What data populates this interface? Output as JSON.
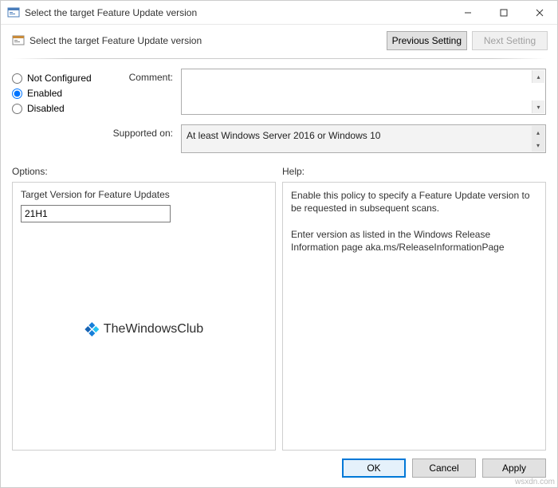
{
  "window": {
    "title": "Select the target Feature Update version"
  },
  "header": {
    "title": "Select the target Feature Update version",
    "prev_button": "Previous Setting",
    "next_button": "Next Setting"
  },
  "config": {
    "radios": {
      "not_configured": "Not Configured",
      "enabled": "Enabled",
      "disabled": "Disabled",
      "selected": "enabled"
    },
    "comment_label": "Comment:",
    "comment_value": "",
    "supported_label": "Supported on:",
    "supported_value": "At least Windows Server 2016 or Windows 10"
  },
  "columns": {
    "options_label": "Options:",
    "help_label": "Help:",
    "options": {
      "target_version_label": "Target Version for Feature Updates",
      "target_version_value": "21H1"
    },
    "help_text": "Enable this policy to specify a Feature Update version to be requested in subsequent scans.\n\nEnter version as listed in the Windows Release Information page aka.ms/ReleaseInformationPage"
  },
  "watermark": {
    "text": "TheWindowsClub"
  },
  "footer": {
    "ok": "OK",
    "cancel": "Cancel",
    "apply": "Apply"
  },
  "source_tag": "wsxdn.com"
}
